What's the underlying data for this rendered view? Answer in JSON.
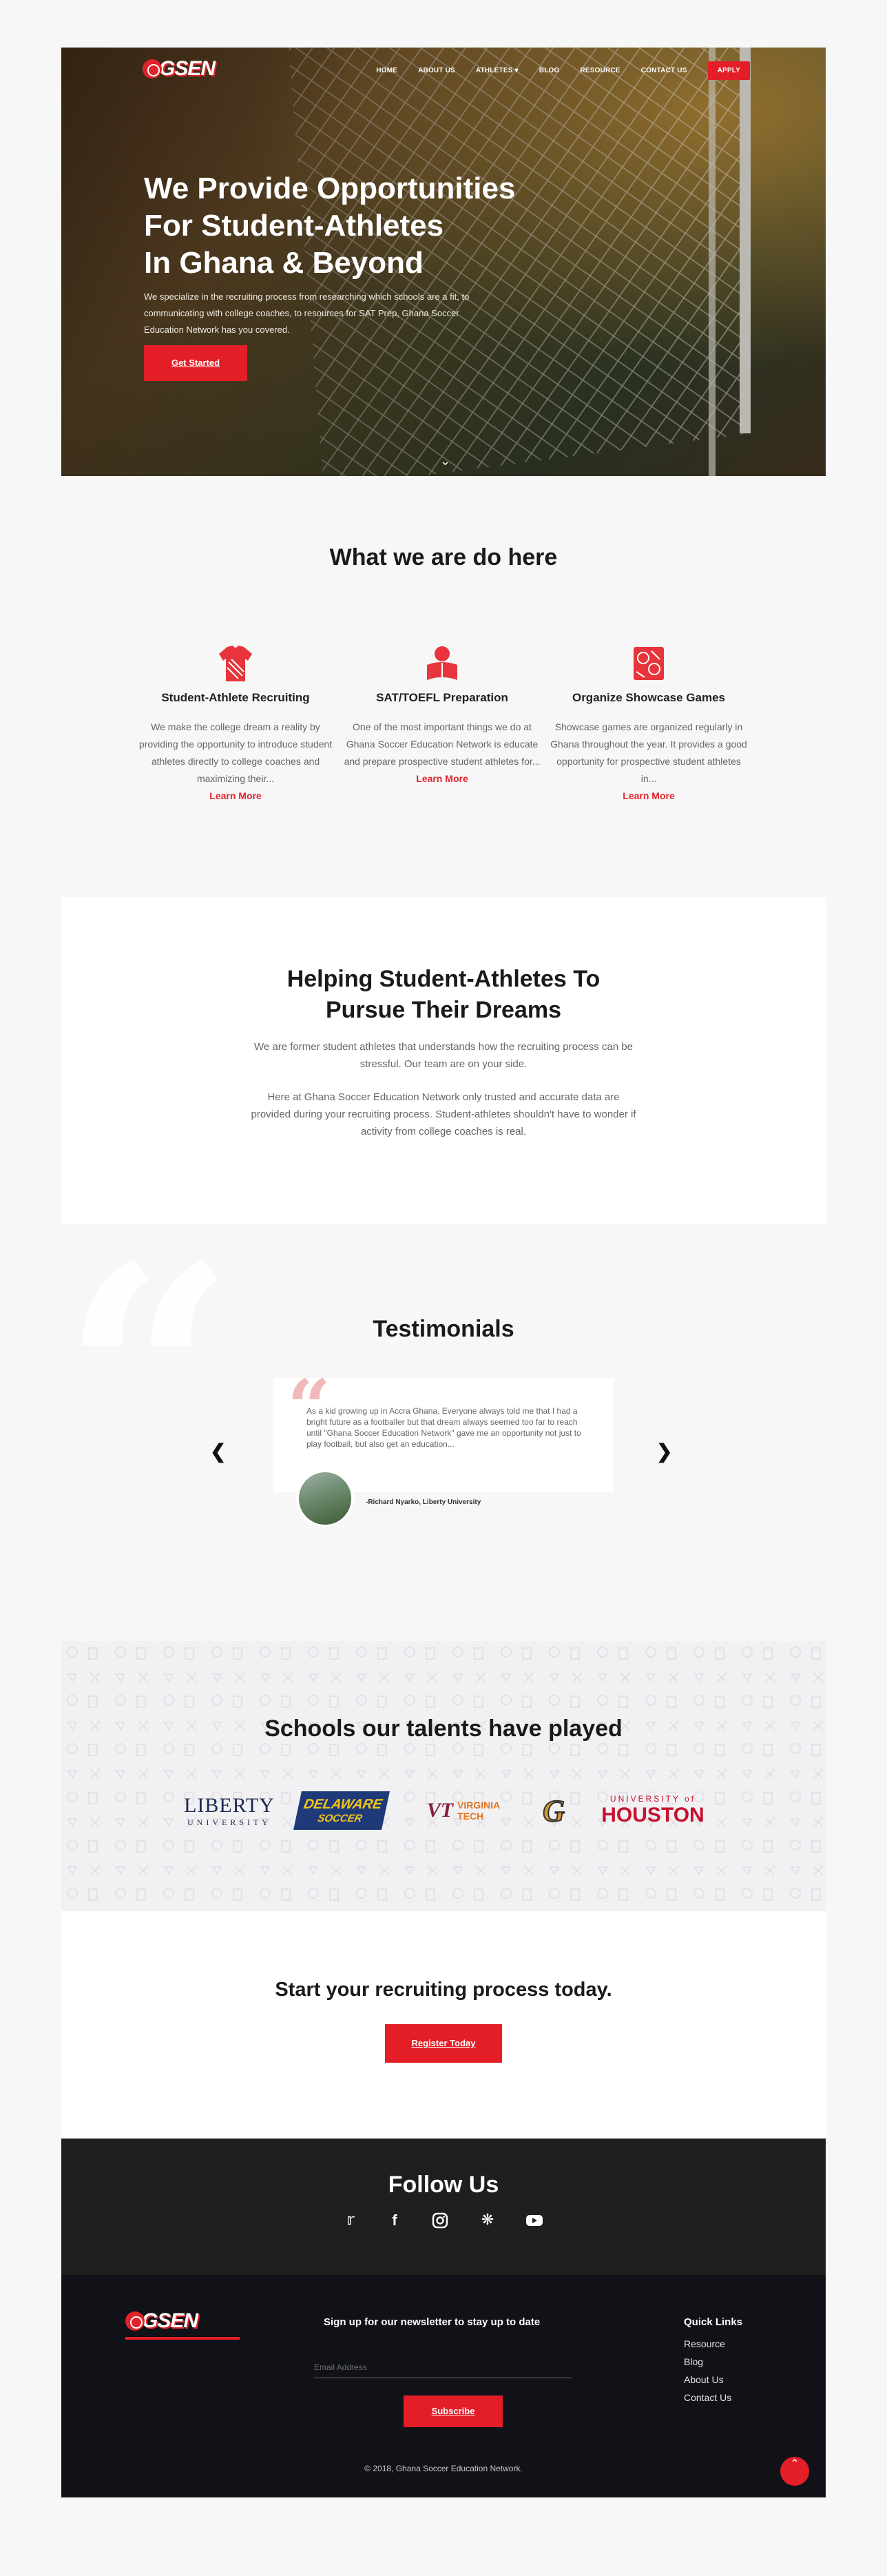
{
  "brand": {
    "logo_text": "GSEN",
    "accent": "#e41e26"
  },
  "nav": {
    "home": "HOME",
    "about": "ABOUT US",
    "athletes": "ATHLETES",
    "blog": "BLOG",
    "resource": "RESOURCE",
    "contact": "CONTACT US",
    "apply": "APPLY"
  },
  "hero": {
    "title_lines": [
      "We Provide Opportunities",
      "For Student-Athletes",
      "In Ghana & Beyond"
    ],
    "subtitle": "We specialize in the recruiting process from researching which schools are a fit, to communicating with college coaches, to resources for SAT Prep, Ghana Soccer Education Network  has you covered.",
    "cta": "Get Started"
  },
  "what": {
    "title": "What we are do here",
    "features": [
      {
        "icon": "jersey-icon",
        "title": "Student-Athlete Recruiting",
        "text": "We make the college dream a reality by providing the opportunity to introduce student athletes directly to college coaches and maximizing their...",
        "link": "Learn More"
      },
      {
        "icon": "reading-student-icon",
        "title": "SAT/TOEFL Preparation",
        "text": "One of the most important things we do at Ghana Soccer Education Network is educate and prepare prospective student athletes for...",
        "link": "Learn More"
      },
      {
        "icon": "sports-equipment-icon",
        "title": "Organize Showcase Games",
        "text": "Showcase games are organized regularly in Ghana throughout the year. It provides a good opportunity for prospective student athletes in...",
        "link": "Learn More"
      }
    ]
  },
  "help": {
    "title_lines": [
      "Helping Student-Athletes To",
      "Pursue Their Dreams"
    ],
    "p1": "We are former student athletes that understands how the recruiting process can be stressful. Our team are on your side.",
    "p2": "Here at Ghana Soccer Education Network only trusted and accurate data are provided during your recruiting process. Student-athletes shouldn't have to wonder if activity from college coaches is real."
  },
  "testimonials": {
    "title": "Testimonials",
    "quote": "As a kid growing up in Accra Ghana, Everyone always told me that I had a bright future as a footballer but that dream always seemed too far to reach until \"Ghana Soccer Education Network\" gave me an opportunity not just to play football, but also get an education...",
    "author": "-Richard Nyarko, Liberty University"
  },
  "schools": {
    "title": "Schools our talents have played",
    "logos": [
      {
        "line1": "LIBERTY",
        "line2": "UNIVERSITY"
      },
      {
        "line1": "DELAWARE",
        "line2": "SOCCER"
      },
      {
        "line1": "VIRGINIA",
        "line2": "TECH"
      },
      {
        "line1": "G",
        "line2": ""
      },
      {
        "line1": "UNIVERSITY of",
        "line2": "HOUSTON"
      }
    ]
  },
  "register": {
    "title": "Start your recruiting process today.",
    "button": "Register Today"
  },
  "follow": {
    "title": "Follow Us"
  },
  "footer": {
    "newsletter_title": "Sign up for our newsletter to stay up to date",
    "email_placeholder": "Email Address",
    "subscribe": "Subscribe",
    "quick_links_title": "Quick Links",
    "links": [
      "Resource",
      "Blog",
      "About Us",
      "Contact Us"
    ],
    "copyright": "© 2018, Ghana Soccer Education Network."
  }
}
